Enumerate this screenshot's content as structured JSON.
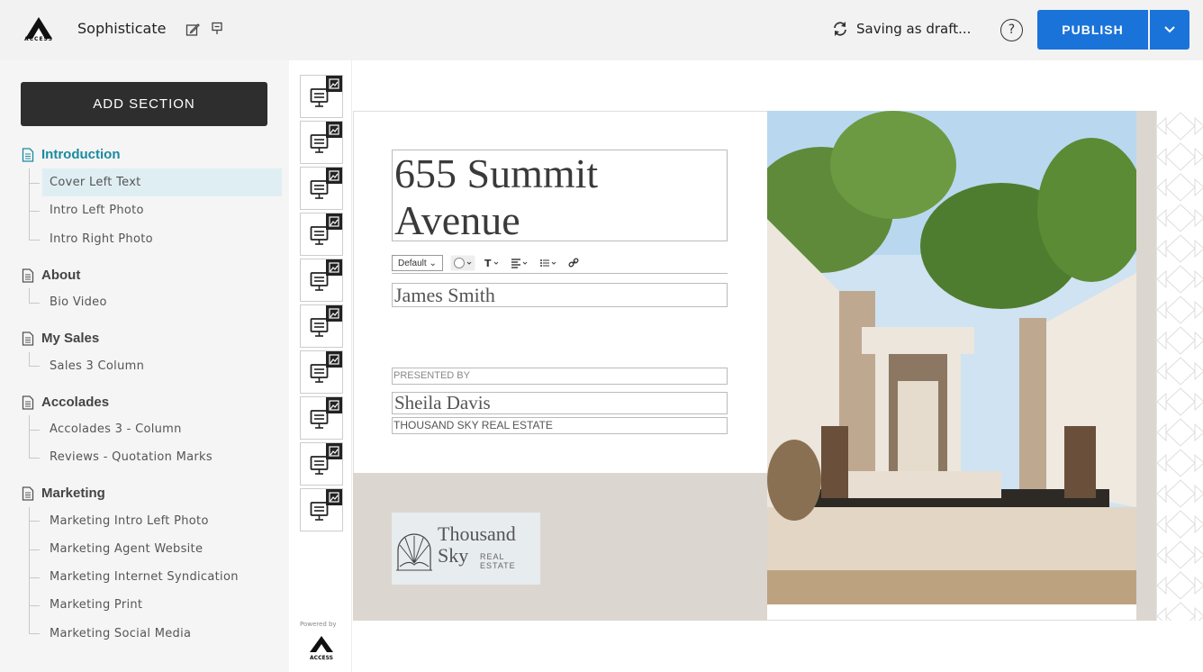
{
  "header": {
    "app_title": "Sophisticate",
    "logo_text": "ACCESS",
    "saving_status": "Saving as draft...",
    "help_label": "?",
    "publish_label": "PUBLISH"
  },
  "sidebar": {
    "add_section_label": "ADD SECTION",
    "sections": [
      {
        "title": "Introduction",
        "active": true,
        "items": [
          "Cover Left Text",
          "Intro Left Photo",
          "Intro Right Photo"
        ]
      },
      {
        "title": "About",
        "items": [
          "Bio Video"
        ]
      },
      {
        "title": "My Sales",
        "items": [
          "Sales 3 Column"
        ]
      },
      {
        "title": "Accolades",
        "items": [
          "Accolades 3 - Column",
          "Reviews - Quotation Marks"
        ]
      },
      {
        "title": "Marketing",
        "items": [
          "Marketing Intro Left Photo",
          "Marketing Agent Website",
          "Marketing Internet Syndication",
          "Marketing Print",
          "Marketing Social Media"
        ]
      }
    ],
    "selected_item": "Cover Left Text"
  },
  "thumbstrip": {
    "powered_by": "Powered by",
    "logo_text": "ACCESS"
  },
  "page": {
    "headline": "655 Summit Avenue",
    "agent_name": "James Smith",
    "presented_by": "PRESENTED BY",
    "presenter_name": "Sheila Davis",
    "brokerage": "THOUSAND SKY REAL ESTATE",
    "brand_name_line1": "Thousand",
    "brand_name_line2": "Sky",
    "brand_sub": "REAL ESTATE",
    "toolbar": {
      "style_select": "Default",
      "icons": [
        "color-picker-icon",
        "text-size-icon",
        "align-icon",
        "list-icon",
        "link-icon"
      ]
    }
  },
  "colors": {
    "accent": "#1a73d9",
    "active_section": "#1a8aa0",
    "beige": "#dcd6d1"
  }
}
